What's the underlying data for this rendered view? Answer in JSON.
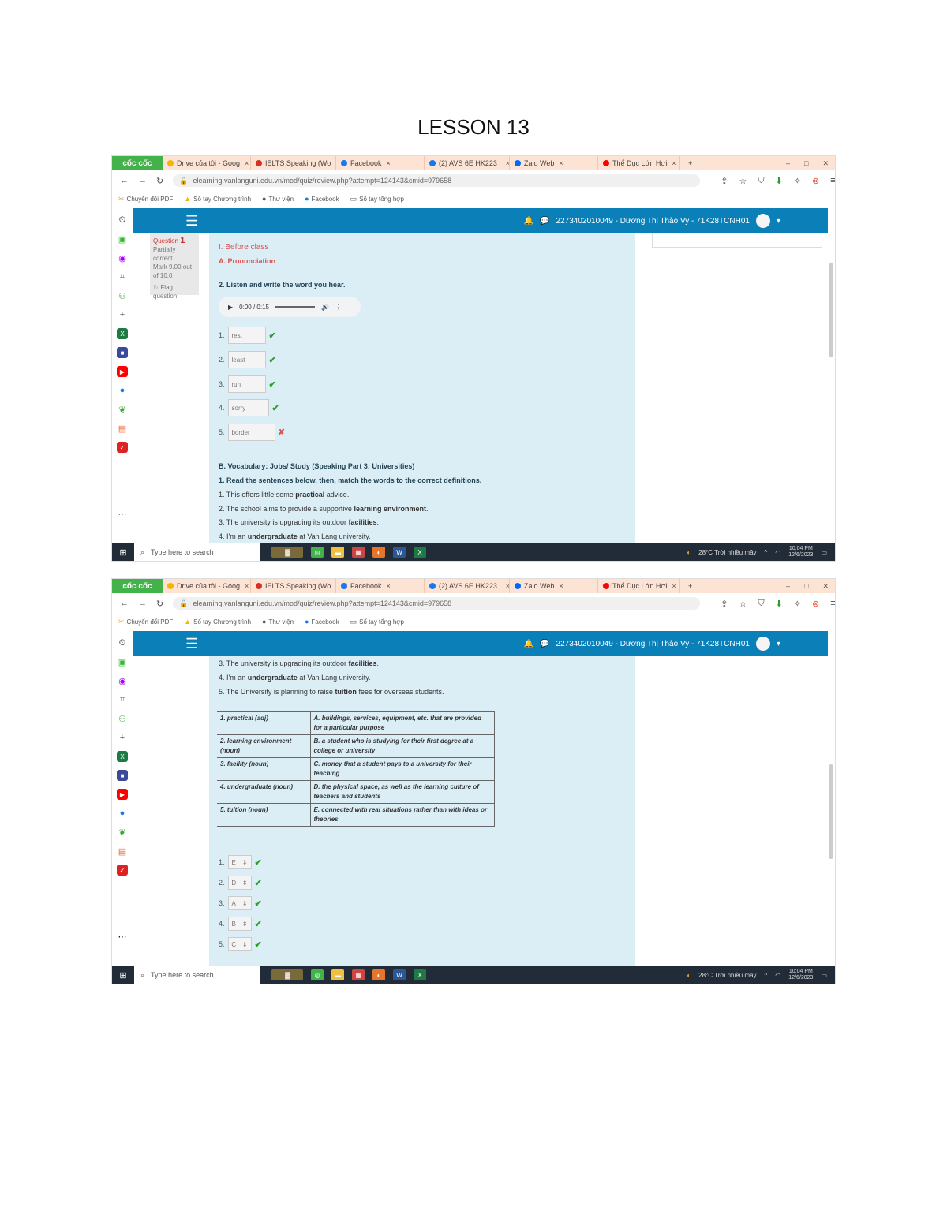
{
  "document": {
    "title": "LESSON 13"
  },
  "browser": {
    "brand": "cốc cốc",
    "tabs": [
      {
        "label": "Drive của tôi - Goog",
        "icon_color": "#f4b400"
      },
      {
        "label": "IELTS Speaking (Wo",
        "icon_color": "#d93025"
      },
      {
        "label": "Facebook",
        "icon_color": "#1877f2"
      },
      {
        "label": "(2) AVS 6E HK223 |",
        "icon_color": "#1877f2"
      },
      {
        "label": "Zalo Web",
        "icon_color": "#0068ff"
      },
      {
        "label": "Thể Dục Lớn Hơi",
        "icon_color": "#ff0000"
      }
    ],
    "tab_close": "×",
    "new_tab": "+",
    "url": "elearning.vanlanguni.edu.vn/mod/quiz/review.php?attempt=124143&cmid=979658",
    "bookmarks": [
      {
        "label": "Chuyển đổi PDF",
        "icon": "tool-icon"
      },
      {
        "label": "Sổ tay Chương trình",
        "icon": "drive-icon"
      },
      {
        "label": "Thư viện",
        "icon": "github-icon"
      },
      {
        "label": "Facebook",
        "icon": "facebook-icon"
      },
      {
        "label": "Sổ tay tổng hợp",
        "icon": "folder-icon"
      }
    ]
  },
  "header": {
    "user": "2273402010049 - Dương Thị Thảo Vy - 71K28TCNH01",
    "menu_icon": "menu-icon"
  },
  "quiz_nav": {
    "question_label": "Question",
    "question_number": "1",
    "status": "Partially correct",
    "mark": "Mark 9.00 out of 10.0",
    "flag": "Flag question"
  },
  "screen1": {
    "section_title": "I. Before class",
    "subsection": "A. Pronunciation",
    "instruction": "2. Listen and write the word you hear.",
    "audio": {
      "time": "0:00 / 0:15"
    },
    "answers": [
      {
        "num": "1.",
        "value": "rest",
        "correct": true
      },
      {
        "num": "2.",
        "value": "least",
        "correct": true
      },
      {
        "num": "3.",
        "value": "run",
        "correct": true
      },
      {
        "num": "4.",
        "value": "sorry",
        "correct": true
      },
      {
        "num": "5.",
        "value": "border",
        "correct": false
      }
    ],
    "vocab_title": "B. Vocabulary: Jobs/ Study (Speaking Part 3: Universities)",
    "vocab_instruction": "1. Read the sentences below, then, match the words to the correct definitions.",
    "sentences": [
      {
        "num": "1.",
        "before": "This offers little some",
        "bold": "practical",
        "after": "advice."
      },
      {
        "num": "2.",
        "before": "The school aims to provide a supportive",
        "bold": "learning environment",
        "after": "."
      },
      {
        "num": "3.",
        "before": "The university is upgrading its outdoor",
        "bold": "facilities",
        "after": "."
      },
      {
        "num": "4.",
        "before": "I'm an",
        "bold": "undergraduate",
        "after": "at Van Lang university."
      }
    ]
  },
  "screen2": {
    "sentences": [
      {
        "num": "3.",
        "before": "The university is upgrading its outdoor",
        "bold": "facilities",
        "after": "."
      },
      {
        "num": "4.",
        "before": "I'm an",
        "bold": "undergraduate",
        "after": "at Van Lang university."
      },
      {
        "num": "5.",
        "before": "The University is planning to raise",
        "bold": "tuition",
        "after": "fees for overseas students."
      }
    ],
    "table": [
      {
        "term": "1. practical (adj)",
        "definition": "A. buildings, services, equipment, etc. that are provided for a particular purpose"
      },
      {
        "term": "2. learning environment (noun)",
        "definition": "B. a student who is studying for their first degree at a college or university"
      },
      {
        "term": "3. facility (noun)",
        "definition": "C. money that a student pays to a university for their teaching"
      },
      {
        "term": "4. undergraduate (noun)",
        "definition": "D. the physical space, as well as the learning culture of teachers and students"
      },
      {
        "term": "5. tuition (noun)",
        "definition": "E. connected with real situations rather than with ideas or theories"
      }
    ],
    "selections": [
      {
        "num": "1.",
        "value": "E"
      },
      {
        "num": "2.",
        "value": "D"
      },
      {
        "num": "3.",
        "value": "A"
      },
      {
        "num": "4.",
        "value": "B"
      },
      {
        "num": "5.",
        "value": "C"
      }
    ]
  },
  "taskbar": {
    "search_placeholder": "Type here to search",
    "weather": "28°C Trời nhiều mây",
    "time": "10:04 PM",
    "date": "12/6/2023"
  },
  "colors": {
    "header_blue": "#0a7fb8",
    "content_bg": "#dbeef6",
    "tabbar_bg": "#fde3d3",
    "correct": "#2a9d2a",
    "incorrect": "#d9534f"
  }
}
